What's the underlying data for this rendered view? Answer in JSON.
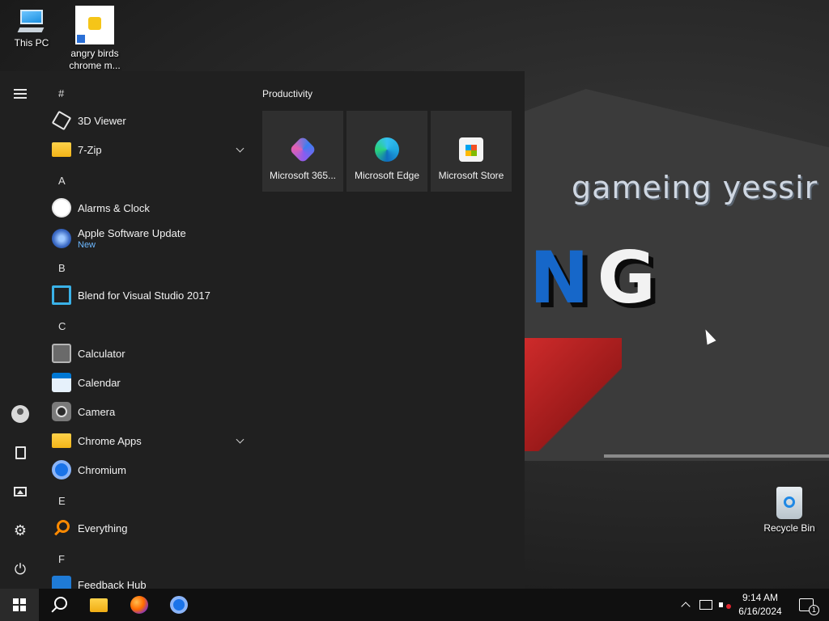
{
  "desktop": {
    "icons": [
      {
        "label": "This PC",
        "icon": "computer-icon"
      },
      {
        "label": "angry birds chrome m...",
        "icon": "shortcut-icon"
      },
      {
        "label": "Recycle Bin",
        "icon": "recycle-bin-icon"
      }
    ],
    "wallpaper": {
      "caption": "gameing yessir",
      "logo_letters": [
        "N",
        "G"
      ]
    }
  },
  "start_menu": {
    "rail": {
      "menu_icon": "hamburger-icon",
      "account_icon": "user-icon",
      "documents_icon": "document-icon",
      "pictures_icon": "pictures-icon",
      "settings_icon": "gear-icon",
      "power_icon": "power-icon"
    },
    "apps": [
      {
        "type": "letter",
        "text": "#"
      },
      {
        "type": "app",
        "label": "3D Viewer",
        "icon": "cube-icon"
      },
      {
        "type": "app",
        "label": "7-Zip",
        "icon": "folder-icon",
        "expandable": true
      },
      {
        "type": "letter",
        "text": "A"
      },
      {
        "type": "app",
        "label": "Alarms & Clock",
        "icon": "clock-icon"
      },
      {
        "type": "app",
        "label": "Apple Software Update",
        "sublabel": "New",
        "icon": "apple-update-icon"
      },
      {
        "type": "letter",
        "text": "B"
      },
      {
        "type": "app",
        "label": "Blend for Visual Studio 2017",
        "icon": "blend-icon"
      },
      {
        "type": "letter",
        "text": "C"
      },
      {
        "type": "app",
        "label": "Calculator",
        "icon": "calculator-icon"
      },
      {
        "type": "app",
        "label": "Calendar",
        "icon": "calendar-icon"
      },
      {
        "type": "app",
        "label": "Camera",
        "icon": "camera-icon"
      },
      {
        "type": "app",
        "label": "Chrome Apps",
        "icon": "folder-icon",
        "expandable": true
      },
      {
        "type": "app",
        "label": "Chromium",
        "icon": "chromium-icon"
      },
      {
        "type": "letter",
        "text": "E"
      },
      {
        "type": "app",
        "label": "Everything",
        "icon": "search-magnifier-icon"
      },
      {
        "type": "letter",
        "text": "F"
      },
      {
        "type": "app",
        "label": "Feedback Hub",
        "icon": "feedback-icon"
      }
    ],
    "tile_group": {
      "title": "Productivity",
      "tiles": [
        {
          "label": "Microsoft 365...",
          "icon": "microsoft-365-icon"
        },
        {
          "label": "Microsoft Edge",
          "icon": "edge-icon"
        },
        {
          "label": "Microsoft Store",
          "icon": "store-icon"
        }
      ]
    }
  },
  "taskbar": {
    "start_icon": "windows-logo-icon",
    "search_icon": "search-icon",
    "pinned": [
      {
        "name": "File Explorer",
        "icon": "file-explorer-icon"
      },
      {
        "name": "Firefox",
        "icon": "firefox-icon"
      },
      {
        "name": "Chromium",
        "icon": "chromium-icon"
      }
    ],
    "tray": {
      "time": "9:14 AM",
      "date": "6/16/2024",
      "notification_count": "1"
    }
  }
}
